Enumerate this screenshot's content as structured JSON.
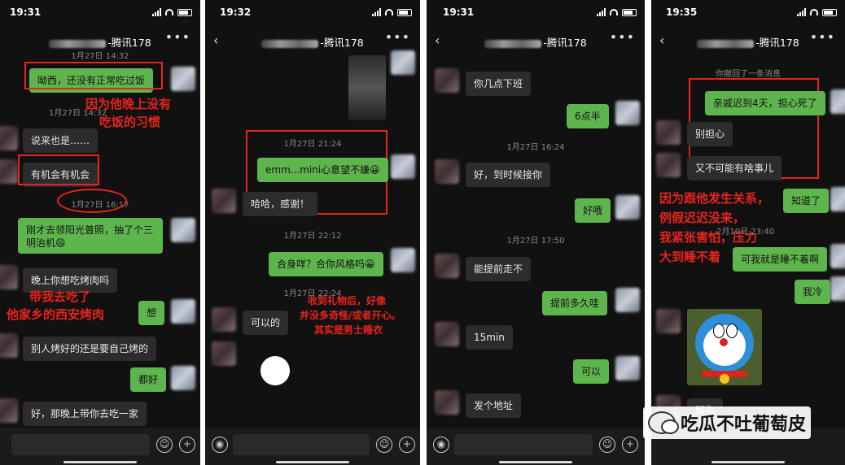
{
  "phones": [
    {
      "time": "19:31",
      "title_suffix": "-腾讯178",
      "timestamps": [
        "1月27日 14:32",
        "1月27日 16:17"
      ],
      "messages": [
        "呦西，还没有正常吃过饭",
        "说来也是……",
        "有机会有机会",
        "刚才去领阳光普照，抽了个三",
        "明治机😄",
        "晚上你想吃烤肉吗",
        "想",
        "别人烤好的还是要自己烤的",
        "都好",
        "好，那晚上带你去吃一家"
      ],
      "notes": [
        "因为他晚上没有",
        "吃饭的习惯",
        "带我去吃了",
        "他家乡的西安烤肉"
      ]
    },
    {
      "time": "19:32",
      "title_suffix": "-腾讯178",
      "timestamps": [
        "1月27日 21:24",
        "1月27日 22:12",
        "1月27日 22:24"
      ],
      "messages": [
        "emm...mini心意望不嫌😀",
        "哈哈，感谢！",
        "合身咩？合你风格吗😀",
        "可以的"
      ],
      "notes": [
        "收到礼物后，好像",
        "并没多奇怪/或者开心。",
        "其实是男士睡衣"
      ]
    },
    {
      "time": "19:31",
      "title_suffix": "-腾讯178",
      "timestamps": [
        "1月27日 16:24",
        "1月27日 17:50"
      ],
      "messages": [
        "你几点下班",
        "6点半",
        "好，到时候接你",
        "好哦",
        "能提前走不",
        "提前多久哇",
        "15min",
        "可以",
        "发个地址"
      ]
    },
    {
      "time": "19:35",
      "title_suffix": "-腾讯178",
      "timestamps": [
        "你撤回了一条消息",
        "2月10日 23:40"
      ],
      "messages": [
        "亲戚迟到4天，担心死了",
        "别担心",
        "又不可能有啥事儿",
        "知道了",
        "可我就是睡不着啊",
        "我冷",
        "那你"
      ],
      "notes": [
        "因为跟他发生关系，",
        "例假迟迟没来，",
        "我紧张害怕，压力",
        "大到睡不着"
      ]
    }
  ],
  "watermark": "吃瓜不吐葡萄皮",
  "icons": {
    "back": "‹",
    "more": "•••",
    "voice": "◉",
    "emoji": "☺",
    "plus": "+"
  },
  "colors": {
    "background": "#111111",
    "green_bubble": "#5fb54d",
    "gray_bubble": "#2c2c2c",
    "annotation": "#e8241c"
  }
}
